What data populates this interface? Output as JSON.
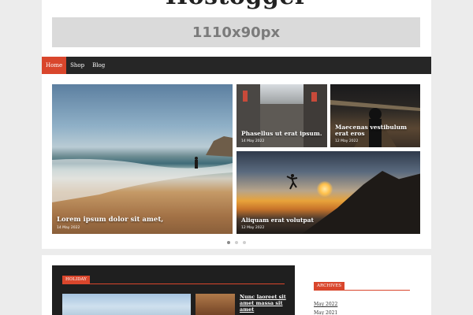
{
  "site": {
    "title": "Hostogger"
  },
  "banner": {
    "text": "1110x90px"
  },
  "nav": {
    "items": [
      {
        "label": "Home"
      },
      {
        "label": "Shop"
      },
      {
        "label": "Blog"
      }
    ]
  },
  "featured": [
    {
      "title": "Lorem ipsum dolor sit amet,",
      "date": "14 May 2022"
    },
    {
      "title": "Phasellus ut erat ipsum.",
      "date": "14 May 2022"
    },
    {
      "title": "Maecenas vestibulum erat eros",
      "date": "12 May 2022"
    },
    {
      "title": "Aliquam erat volutpat",
      "date": "12 May 2022"
    }
  ],
  "slider": {
    "total": 3,
    "active": 1
  },
  "holiday": {
    "label": "HOLIDAY",
    "post_title": "Nunc laoreet sit amet massa sit amet"
  },
  "archives": {
    "label": "ARCHIVES",
    "items": [
      "May 2022",
      "May 2021"
    ]
  },
  "colors": {
    "accent": "#d9462c",
    "nav_bg": "#262626",
    "page_bg": "#ececec"
  }
}
